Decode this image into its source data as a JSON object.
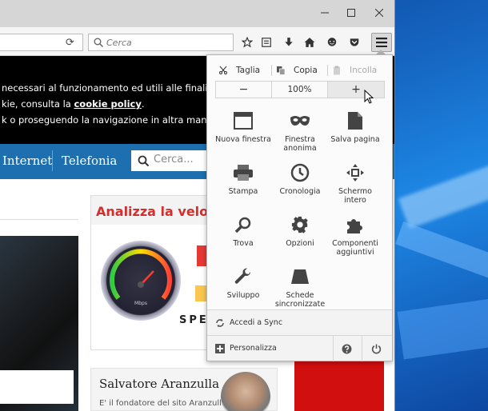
{
  "toolbar": {
    "search_placeholder": "Cerca"
  },
  "cookie_banner": {
    "line1": "necessari al funzionamento ed utili alle finalità illustrat",
    "line2_prefix": "kie, consulta la ",
    "line2_link": "cookie policy",
    "line2_suffix": ".",
    "line3": "k o proseguendo la navigazione in altra maniera, acco"
  },
  "nav": {
    "items": [
      "Internet",
      "Telefonia"
    ],
    "search_placeholder": "Cerca..."
  },
  "banner": {
    "title": "Analizza la velocit",
    "speed_text": "SPEE",
    "gauge_label": "Mbps"
  },
  "author": {
    "name": "Salvatore Aranzulla",
    "subtitle": "E' il fondatore del sito Aranzulla.it,"
  },
  "menu": {
    "edit": {
      "cut": "Taglia",
      "copy": "Copia",
      "paste": "Incolla"
    },
    "zoom": {
      "minus": "−",
      "level": "100%",
      "plus": "+"
    },
    "items": [
      {
        "label": "Nuova finestra",
        "icon": "window-icon"
      },
      {
        "label": "Finestra anonima",
        "icon": "mask-icon"
      },
      {
        "label": "Salva pagina",
        "icon": "page-icon"
      },
      {
        "label": "Stampa",
        "icon": "printer-icon"
      },
      {
        "label": "Cronologia",
        "icon": "clock-icon"
      },
      {
        "label": "Schermo intero",
        "icon": "fullscreen-icon"
      },
      {
        "label": "Trova",
        "icon": "magnifier-icon"
      },
      {
        "label": "Opzioni",
        "icon": "gear-icon"
      },
      {
        "label": "Componenti aggiuntivi",
        "icon": "puzzle-icon"
      },
      {
        "label": "Sviluppo",
        "icon": "wrench-icon"
      },
      {
        "label": "Schede sincronizzate",
        "icon": "sync-tabs-icon"
      }
    ],
    "sync_label": "Accedi a Sync",
    "customize_label": "Personalizza"
  }
}
